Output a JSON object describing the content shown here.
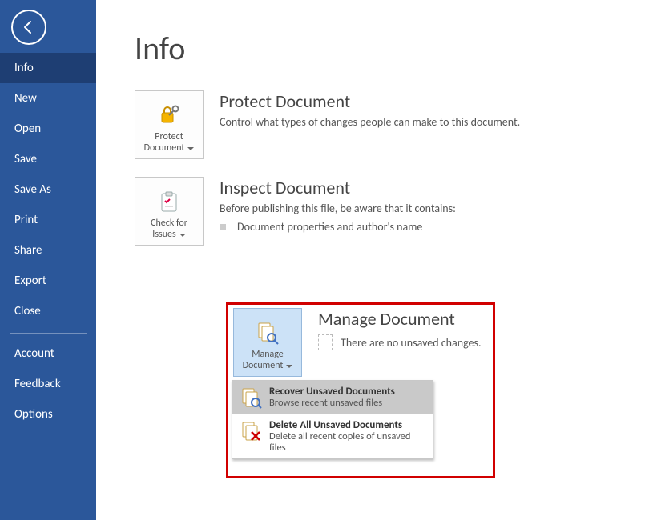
{
  "page": {
    "title": "Info"
  },
  "sidebar": {
    "items": [
      {
        "label": "Info"
      },
      {
        "label": "New"
      },
      {
        "label": "Open"
      },
      {
        "label": "Save"
      },
      {
        "label": "Save As"
      },
      {
        "label": "Print"
      },
      {
        "label": "Share"
      },
      {
        "label": "Export"
      },
      {
        "label": "Close"
      }
    ],
    "footerItems": [
      {
        "label": "Account"
      },
      {
        "label": "Feedback"
      },
      {
        "label": "Options"
      }
    ]
  },
  "protect": {
    "buttonLine1": "Protect",
    "buttonLine2": "Document",
    "title": "Protect Document",
    "text": "Control what types of changes people can make to this document."
  },
  "inspect": {
    "buttonLine1": "Check for",
    "buttonLine2": "Issues",
    "title": "Inspect Document",
    "text": "Before publishing this file, be aware that it contains:",
    "bullet1": "Document properties and author's name"
  },
  "manage": {
    "buttonLine1": "Manage",
    "buttonLine2": "Document",
    "title": "Manage Document",
    "text": "There are no unsaved changes.",
    "menu": [
      {
        "title": "Recover Unsaved Documents",
        "sub": "Browse recent unsaved files"
      },
      {
        "title": "Delete All Unsaved Documents",
        "sub": "Delete all recent copies of unsaved files"
      }
    ]
  }
}
